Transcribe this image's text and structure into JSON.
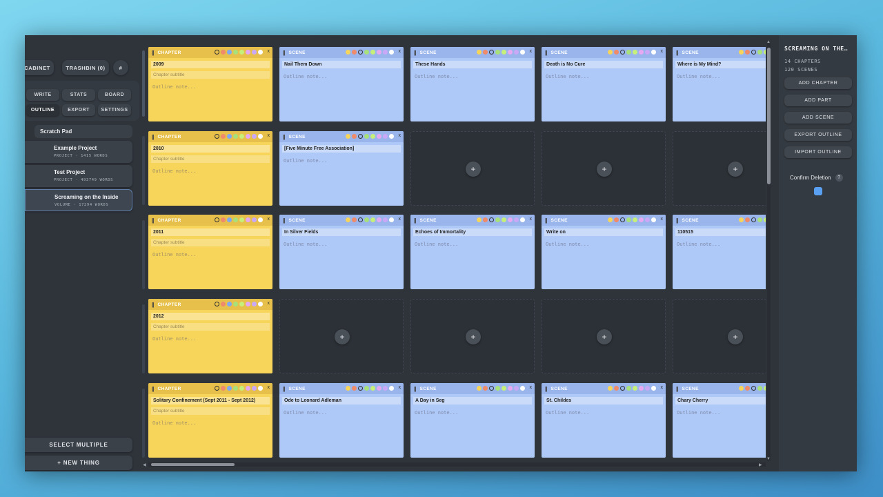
{
  "sidebar": {
    "top_buttons": {
      "cabinet": "CABINET",
      "trashbin": "TRASHBIN (0)",
      "hash": "#"
    },
    "nav": [
      "WRITE",
      "STATS",
      "BOARD",
      "OUTLINE",
      "EXPORT",
      "SETTINGS"
    ],
    "scratch_pad": "Scratch Pad",
    "projects": [
      {
        "title": "Example Project",
        "sub": "PROJECT · 1415 WORDS"
      },
      {
        "title": "Test Project",
        "sub": "PROJECT · 493749 WORDS"
      },
      {
        "title": "Screaming on the Inside",
        "sub": "VOLUME · 17294 WORDS"
      }
    ],
    "select_multiple": "SELECT MULTIPLE",
    "new_thing": "+ NEW THING"
  },
  "board": {
    "chapter_label": "CHAPTER",
    "scene_label": "SCENE",
    "subtitle_placeholder": "Chapter subtitle",
    "note_placeholder": "Outline note...",
    "close": "x",
    "grip": "||",
    "add": "+",
    "rows": [
      {
        "chapter": "2009",
        "scenes": [
          "Nail Them Down",
          "These Hands",
          "Death is No Cure",
          "Where is My Mind?"
        ]
      },
      {
        "chapter": "2010",
        "scenes": [
          "[Five Minute Free Association]"
        ]
      },
      {
        "chapter": "2011",
        "scenes": [
          "In Silver Fields",
          "Echoes of Immortality",
          "Write on",
          "110515"
        ]
      },
      {
        "chapter": "2012",
        "scenes": []
      },
      {
        "chapter": "Solitary Confinement (Sept 2011 - Sept 2012)",
        "scenes": [
          "Ode to Leonard Adleman",
          "A Day in Seg",
          "St. Childes",
          "Chary Cherry"
        ]
      }
    ],
    "dot_colors": [
      "#f7d45a",
      "#ef8a6a",
      "#7fa8f0",
      "#a8e07a",
      "#c6f07a",
      "#e6a8f0",
      "#c9a8f7",
      "#ffffff"
    ]
  },
  "right_panel": {
    "title": "SCREAMING ON THE…",
    "chapters": "14 CHAPTERS",
    "scenes": "120 SCENES",
    "buttons": [
      "ADD CHAPTER",
      "ADD PART",
      "ADD SCENE",
      "EXPORT OUTLINE",
      "IMPORT OUTLINE"
    ],
    "confirm_deletion": "Confirm Deletion",
    "help": "?"
  }
}
